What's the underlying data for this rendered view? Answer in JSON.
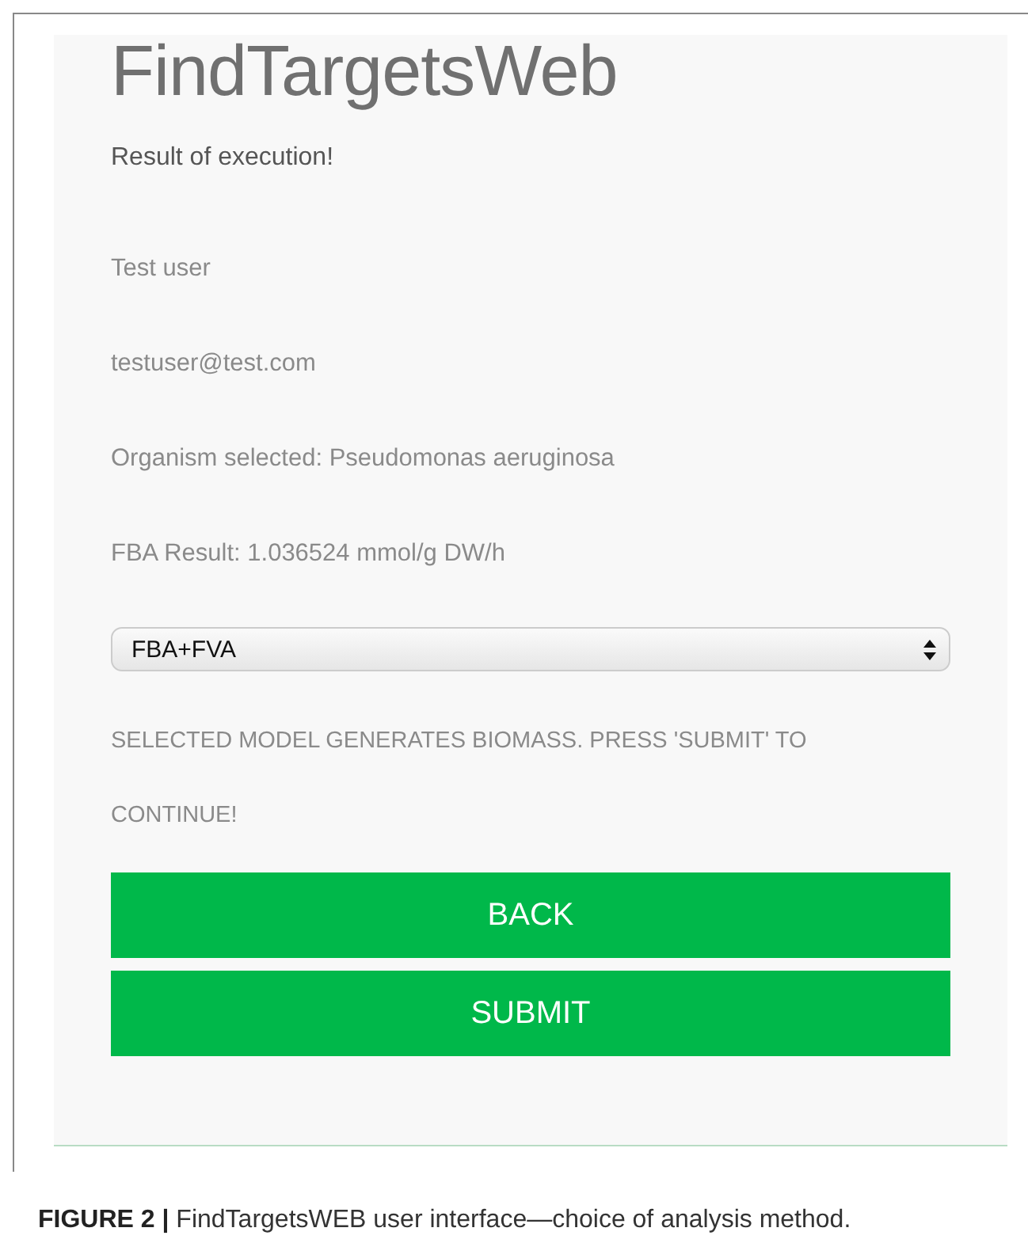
{
  "app": {
    "title": "FindTargetsWeb",
    "subtitle": "Result of execution!",
    "info_lines": [
      "Test user",
      "testuser@test.com",
      "Organism selected: Pseudomonas aeruginosa",
      "FBA Result: 1.036524 mmol/g DW/h"
    ],
    "method_select": {
      "value": "FBA+FVA"
    },
    "message_lines": [
      "SELECTED MODEL GENERATES BIOMASS. PRESS 'SUBMIT' TO",
      "CONTINUE!"
    ],
    "buttons": [
      "BACK",
      "SUBMIT"
    ]
  },
  "caption": "**FIGURE 2 |** FindTargetsWEB user interface—choice of analysis method."
}
